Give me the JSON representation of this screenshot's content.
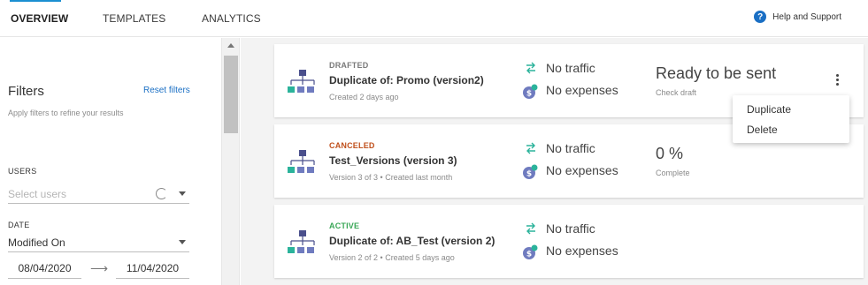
{
  "nav": {
    "tabs": [
      "OVERVIEW",
      "TEMPLATES",
      "ANALYTICS"
    ],
    "help_label": "Help and Support"
  },
  "sidebar": {
    "title": "Filters",
    "reset_label": "Reset filters",
    "subtitle": "Apply filters to refine your results",
    "users_label": "USERS",
    "users_placeholder": "Select users",
    "date_label": "DATE",
    "date_field": "Modified On",
    "date_from": "08/04/2020",
    "date_to": "11/04/2020",
    "date_arrow": "⟶"
  },
  "cards": [
    {
      "status": "DRAFTED",
      "status_color": "#7a7a7a",
      "name": "Duplicate of: Promo (version2)",
      "meta": "Created 2 days ago",
      "traffic": "No traffic",
      "expenses": "No expenses",
      "big": "Ready to be sent",
      "small": "Check draft"
    },
    {
      "status": "CANCELED",
      "status_color": "#c0501c",
      "name": "Test_Versions (version 3)",
      "meta": "Version 3 of 3 • Created last month",
      "traffic": "No traffic",
      "expenses": "No expenses",
      "big": "0 %",
      "small": "Complete"
    },
    {
      "status": "ACTIVE",
      "status_color": "#3aa757",
      "name": "Duplicate of: AB_Test (version 2)",
      "meta": "Version 2 of 2 • Created 5 days ago",
      "traffic": "No traffic",
      "expenses": "No expenses"
    }
  ],
  "menu": {
    "items": [
      "Duplicate",
      "Delete"
    ]
  },
  "colors": {
    "accent": "#1a8fd1",
    "link": "#1a6fc4",
    "traffic_icon": "#2bb39b",
    "expenses_icon": "#6f7bbf"
  }
}
